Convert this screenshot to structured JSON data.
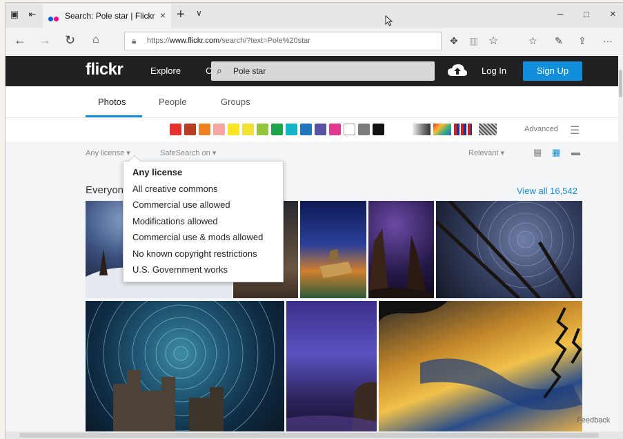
{
  "browser": {
    "tab_title": "Search: Pole star | Flickr",
    "tab_close": "×",
    "new_tab": "+",
    "tab_menu": "∨",
    "url_prefix": "https://",
    "url_domain": "www.flickr.com",
    "url_path": "/search/?text=Pole%20star",
    "window_minimize": "–",
    "window_maximize": "□",
    "window_close": "×",
    "more": "···"
  },
  "flickr": {
    "logo": "flickr",
    "nav_explore": "Explore",
    "nav_partial": "C",
    "search_query": "Pole star",
    "login": "Log In",
    "signup": "Sign Up"
  },
  "tabs": [
    {
      "label": "Photos",
      "active": true
    },
    {
      "label": "People",
      "active": false
    },
    {
      "label": "Groups",
      "active": false
    }
  ],
  "colors": [
    "#e5322c",
    "#b73e22",
    "#f08021",
    "#f4a6a5",
    "#f9e524",
    "#f3e133",
    "#92c63e",
    "#1ea44a",
    "#10b5c9",
    "#2276be",
    "#5852a3",
    "#e23a91",
    "#ffffff",
    "#7b7b7b",
    "#111111"
  ],
  "advanced": "Advanced",
  "filters": {
    "license": "Any license ▾",
    "safesearch": "SafeSearch on ▾",
    "sort": "Relevant ▾"
  },
  "section": {
    "title": "Everyon",
    "view_all": "View all 16,542"
  },
  "license_menu": [
    {
      "label": "Any license",
      "selected": true
    },
    {
      "label": "All creative commons",
      "selected": false
    },
    {
      "label": "Commercial use allowed",
      "selected": false
    },
    {
      "label": "Modifications allowed",
      "selected": false
    },
    {
      "label": "Commercial use & mods allowed",
      "selected": false
    },
    {
      "label": "No known copyright restrictions",
      "selected": false
    },
    {
      "label": "U.S. Government works",
      "selected": false
    }
  ],
  "feedback": "Feedback"
}
